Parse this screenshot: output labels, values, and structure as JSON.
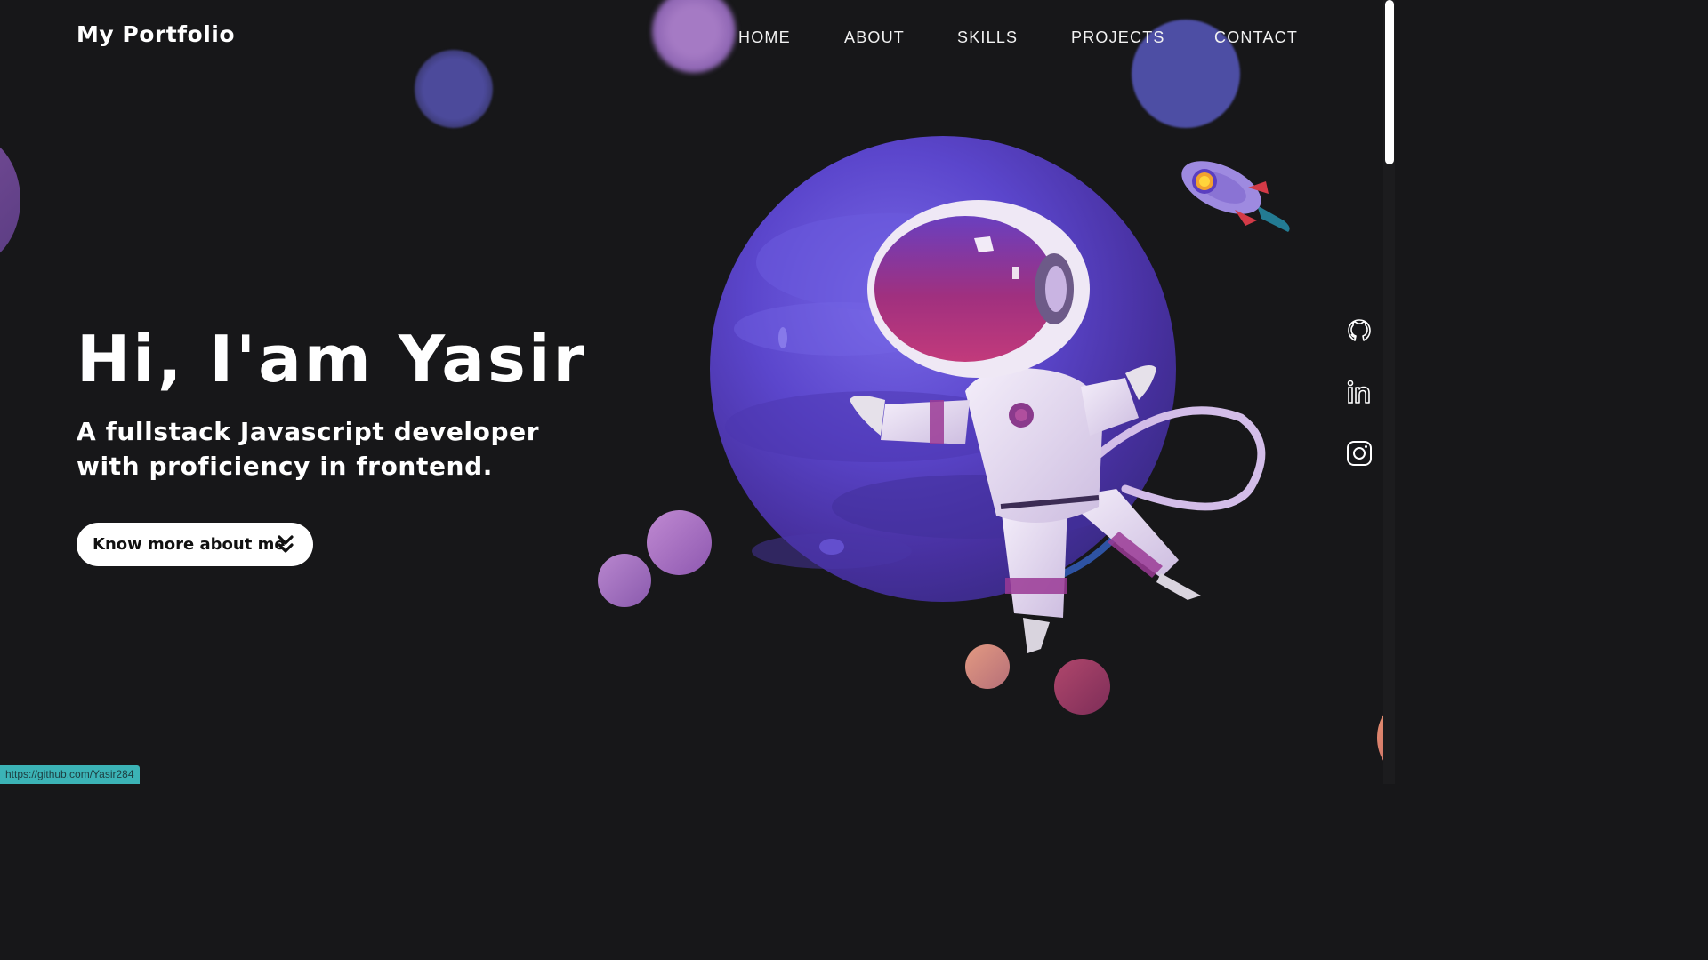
{
  "navbar": {
    "logo": "My Portfolio",
    "links": [
      "HOME",
      "ABOUT",
      "SKILLS",
      "PROJECTS",
      "CONTACT"
    ]
  },
  "hero": {
    "title": "Hi, I'am Yasir",
    "subtitle": "A fullstack Javascript developer with proficiency in frontend.",
    "cta_label": "Know more about me",
    "cta_icon": "double-chevron-down-icon"
  },
  "social": [
    "github-icon",
    "linkedin-icon",
    "instagram-icon"
  ],
  "status_bar": {
    "url": "https://github.com/Yasir284"
  },
  "colors": {
    "background": "#171719",
    "planet": "#5b3ec0",
    "accent_purple": "#a57ac4",
    "status_teal": "#3bb3b6"
  }
}
